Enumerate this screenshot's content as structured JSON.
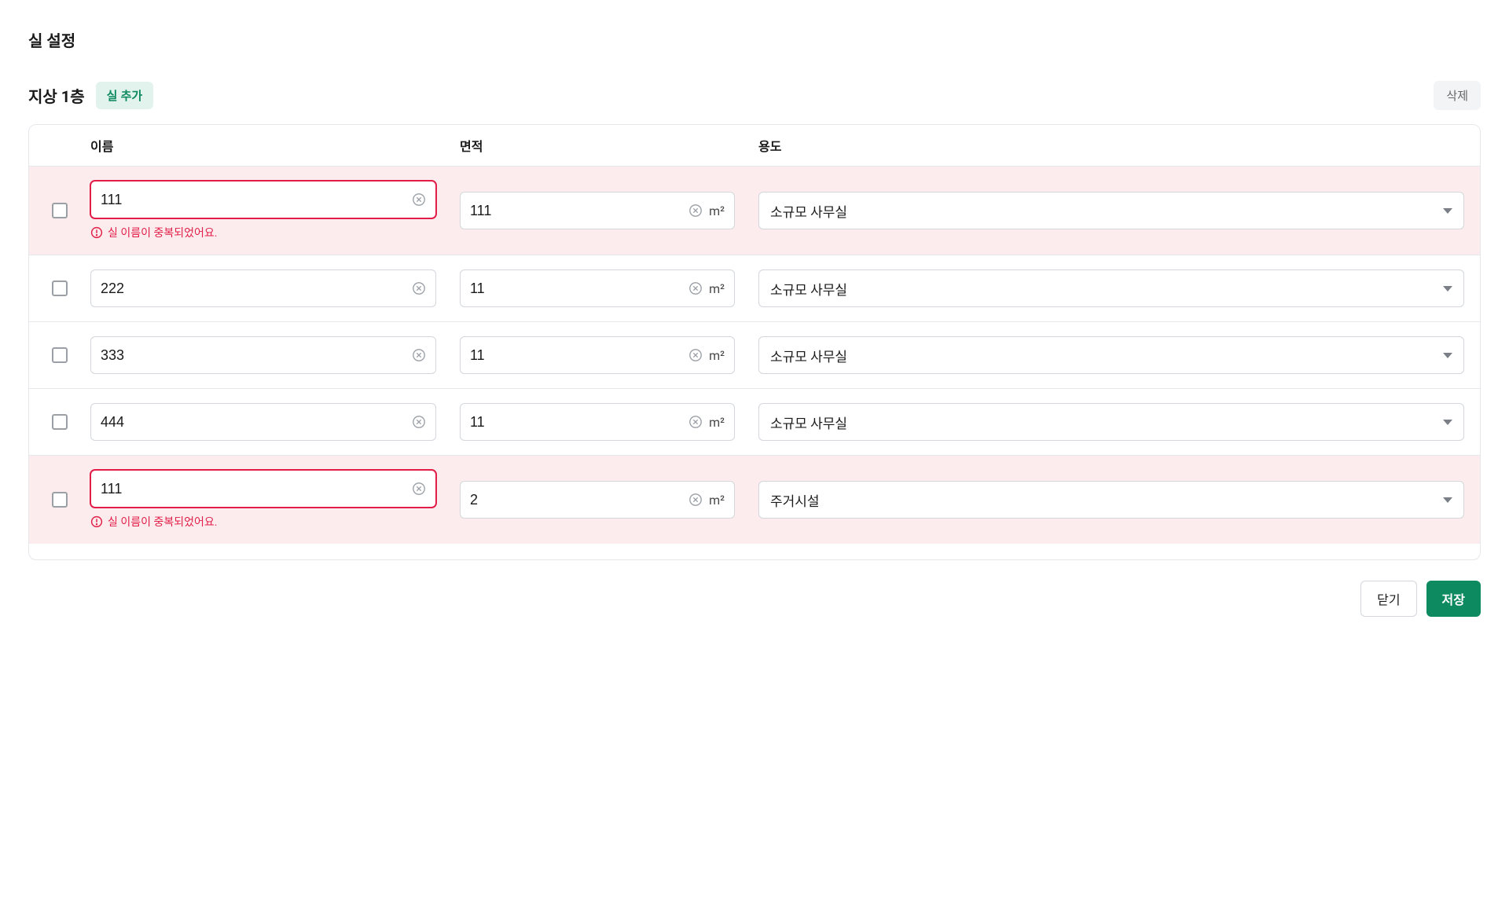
{
  "page_title": "실 설정",
  "floor": {
    "title": "지상 1층",
    "add_label": "실 추가",
    "delete_label": "삭제"
  },
  "columns": {
    "name": "이름",
    "area": "면적",
    "usage": "용도"
  },
  "area_unit": "m²",
  "error_message": "실 이름이 중복되었어요.",
  "rows": [
    {
      "name": "111",
      "area": "111",
      "usage": "소규모 사무실",
      "error": true
    },
    {
      "name": "222",
      "area": "11",
      "usage": "소규모 사무실",
      "error": false
    },
    {
      "name": "333",
      "area": "11",
      "usage": "소규모 사무실",
      "error": false
    },
    {
      "name": "444",
      "area": "11",
      "usage": "소규모 사무실",
      "error": false
    },
    {
      "name": "111",
      "area": "2",
      "usage": "주거시설",
      "error": true
    }
  ],
  "footer": {
    "close": "닫기",
    "save": "저장"
  }
}
